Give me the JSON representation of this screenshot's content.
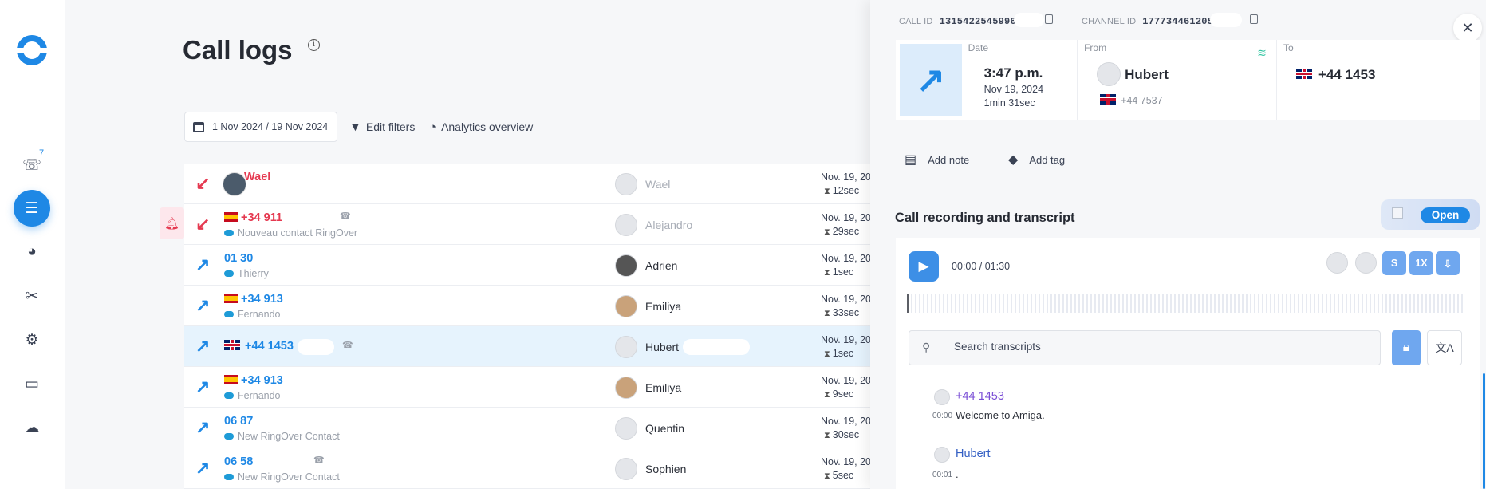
{
  "nav": {
    "badge": "7",
    "items": [
      "phone-icon",
      "list-icon",
      "pie-chart-icon",
      "tools-icon",
      "gear-icon",
      "code-icon",
      "cloud-icon"
    ]
  },
  "page": {
    "title": "Call logs",
    "date_range": "1 Nov 2024 / 19 Nov 2024",
    "edit_filters": "Edit filters",
    "analytics": "Analytics overview"
  },
  "calls": [
    {
      "number": "Wael",
      "sub": "",
      "agent": "Wael",
      "date": "Nov. 19, 20",
      "duration": "12sec",
      "missed": true
    },
    {
      "number": "+34 911",
      "sub": "Nouveau contact RingOver",
      "agent": "Alejandro",
      "date": "Nov. 19, 20",
      "duration": "29sec",
      "missed": true
    },
    {
      "number": "01 30",
      "sub": "Thierry",
      "agent": "Adrien",
      "date": "Nov. 19, 20",
      "duration": "1sec",
      "missed": false
    },
    {
      "number": "+34 913",
      "sub": "Fernando",
      "agent": "Emiliya",
      "date": "Nov. 19, 20",
      "duration": "33sec",
      "missed": false
    },
    {
      "number": "+44 1453",
      "sub": "",
      "agent": "Hubert",
      "date": "Nov. 19, 20",
      "duration": "1sec",
      "missed": false
    },
    {
      "number": "+34 913",
      "sub": "Fernando",
      "agent": "Emiliya",
      "date": "Nov. 19, 20",
      "duration": "9sec",
      "missed": false
    },
    {
      "number": "06 87",
      "sub": "New RingOver Contact",
      "agent": "Quentin",
      "date": "Nov. 19, 20",
      "duration": "30sec",
      "missed": false
    },
    {
      "number": "06 58",
      "sub": "New RingOver Contact",
      "agent": "Sophien",
      "date": "Nov. 19, 20",
      "duration": "5sec",
      "missed": false
    }
  ],
  "detail": {
    "call_id_label": "CALL ID",
    "call_id": "13154225459962",
    "channel_id_label": "CHANNEL ID",
    "channel_id": "17773446120511",
    "date_label": "Date",
    "time": "3:47 p.m.",
    "date": "Nov 19, 2024",
    "duration": "1min 31sec",
    "from_label": "From",
    "from_name": "Hubert",
    "from_number": "+44 7537",
    "to_label": "To",
    "to_number": "+44 1453",
    "add_note": "Add note",
    "add_tag": "Add tag",
    "recording_title": "Call recording and transcript",
    "open_label": "Open",
    "time_current": "00:00",
    "time_sep": "/",
    "time_total": "01:30",
    "speed_s": "S",
    "speed_1x": "1X",
    "search_placeholder": "Search transcripts",
    "transcript": [
      {
        "speaker": "+44 1453",
        "stamp": "00:00",
        "text": "Welcome to Amiga.",
        "color": "#7b4fd6"
      },
      {
        "speaker": "Hubert",
        "stamp": "00:01",
        "text": ".",
        "color": "#3560c4"
      }
    ]
  },
  "colors": {
    "accent": "#1e88e5",
    "missed": "#e53950"
  }
}
